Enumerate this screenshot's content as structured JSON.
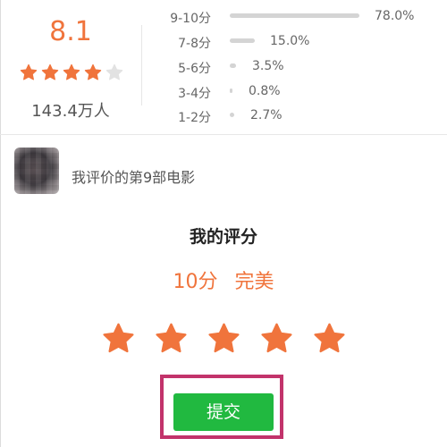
{
  "summary": {
    "score": "8.1",
    "star_count_filled": 4,
    "star_count_total": 5,
    "rating_count": "143.4万人"
  },
  "distribution": [
    {
      "label": "9-10分",
      "percent": "78.0%",
      "fraction": 0.78
    },
    {
      "label": "7-8分",
      "percent": "15.0%",
      "fraction": 0.15
    },
    {
      "label": "5-6分",
      "percent": "3.5%",
      "fraction": 0.035
    },
    {
      "label": "3-4分",
      "percent": "0.8%",
      "fraction": 0.008
    },
    {
      "label": "1-2分",
      "percent": "2.7%",
      "fraction": 0.027
    }
  ],
  "user": {
    "text": "我评价的第9部电影"
  },
  "my_rating": {
    "title": "我的评分",
    "score": "10分",
    "label": "完美",
    "stars": 5
  },
  "submit_label": "提交",
  "colors": {
    "accent": "#f0743c",
    "star_empty": "#e2e2e2",
    "submit": "#21b940",
    "highlight": "#c2336b"
  }
}
